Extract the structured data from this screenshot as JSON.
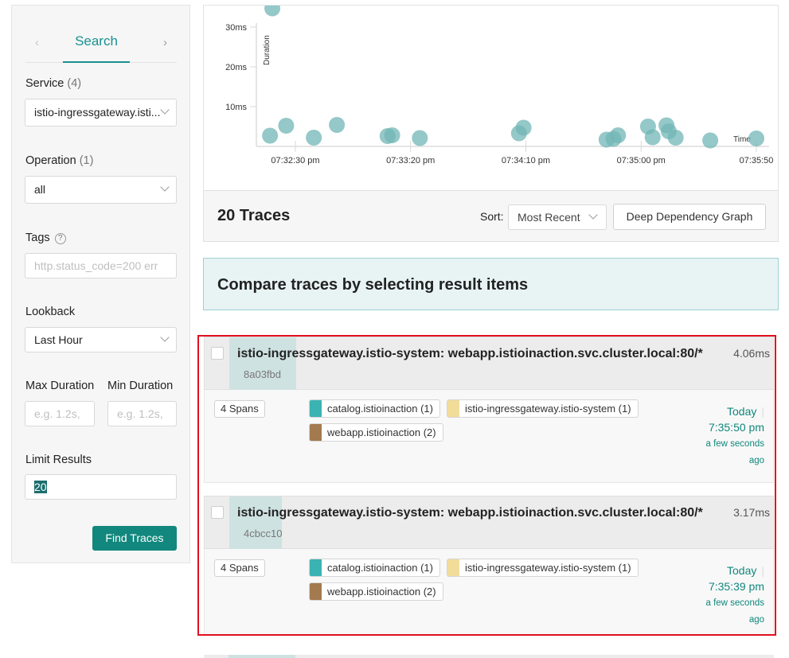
{
  "sidebar": {
    "tab_search": "Search",
    "tab_prev_icon": "‹",
    "tab_next_icon": "›",
    "service_label": "Service",
    "service_count": "(4)",
    "service_value": "istio-ingressgateway.isti...",
    "operation_label": "Operation",
    "operation_count": "(1)",
    "operation_value": "all",
    "tags_label": "Tags",
    "tags_help_icon": "?",
    "tags_placeholder": "http.status_code=200 err",
    "lookback_label": "Lookback",
    "lookback_value": "Last Hour",
    "max_duration_label": "Max Duration",
    "max_duration_placeholder": "e.g. 1.2s,",
    "min_duration_label": "Min Duration",
    "min_duration_placeholder": "e.g. 1.2s,",
    "limit_label": "Limit Results",
    "limit_value": "20",
    "find_button": "Find Traces"
  },
  "chart_data": {
    "type": "scatter",
    "xlabel": "Time",
    "ylabel": "Duration",
    "y_ticks": [
      "10ms",
      "20ms",
      "30ms"
    ],
    "x_ticks": [
      "07:32:30 pm",
      "07:33:20 pm",
      "07:34:10 pm",
      "07:35:00 pm",
      "07:35:50"
    ],
    "point_color": "#71b5b5",
    "points": [
      {
        "x": "07:32:20",
        "y": 33.5
      },
      {
        "x": "07:32:19",
        "y": 1.5
      },
      {
        "x": "07:32:26",
        "y": 4.0
      },
      {
        "x": "07:32:38",
        "y": 1.0
      },
      {
        "x": "07:32:48",
        "y": 4.2
      },
      {
        "x": "07:33:10",
        "y": 1.4
      },
      {
        "x": "07:33:12",
        "y": 1.6
      },
      {
        "x": "07:33:24",
        "y": 0.9
      },
      {
        "x": "07:34:07",
        "y": 2.1
      },
      {
        "x": "07:34:09",
        "y": 3.5
      },
      {
        "x": "07:34:45",
        "y": 0.5
      },
      {
        "x": "07:34:48",
        "y": 0.7
      },
      {
        "x": "07:34:50",
        "y": 1.6
      },
      {
        "x": "07:35:03",
        "y": 3.8
      },
      {
        "x": "07:35:05",
        "y": 1.1
      },
      {
        "x": "07:35:11",
        "y": 4.1
      },
      {
        "x": "07:35:12",
        "y": 2.6
      },
      {
        "x": "07:35:15",
        "y": 1.0
      },
      {
        "x": "07:35:30",
        "y": 0.3
      },
      {
        "x": "07:35:50",
        "y": 0.8
      }
    ]
  },
  "results": {
    "count_label": "20 Traces",
    "sort_label": "Sort:",
    "sort_value": "Most Recent",
    "ddg_button": "Deep Dependency Graph",
    "compare_text": "Compare traces by selecting result items"
  },
  "traces": [
    {
      "title": "istio-ingressgateway.istio-system: webapp.istioinaction.svc.cluster.local:80/*",
      "id": "8a03fbd",
      "duration": "4.06ms",
      "spans": "4 Spans",
      "services": [
        {
          "name": "catalog.istioinaction (1)",
          "color": "#3bb3b3"
        },
        {
          "name": "istio-ingressgateway.istio-system (1)",
          "color": "#f2dc9a"
        },
        {
          "name": "webapp.istioinaction (2)",
          "color": "#a37a4f"
        }
      ],
      "day": "Today",
      "time": "7:35:50 pm",
      "ago_line1": "a few seconds",
      "ago_line2": "ago"
    },
    {
      "title": "istio-ingressgateway.istio-system: webapp.istioinaction.svc.cluster.local:80/*",
      "id": "4cbcc10",
      "duration": "3.17ms",
      "spans": "4 Spans",
      "services": [
        {
          "name": "catalog.istioinaction (1)",
          "color": "#3bb3b3"
        },
        {
          "name": "istio-ingressgateway.istio-system (1)",
          "color": "#f2dc9a"
        },
        {
          "name": "webapp.istioinaction (2)",
          "color": "#a37a4f"
        }
      ],
      "day": "Today",
      "time": "7:35:39 pm",
      "ago_line1": "a few seconds",
      "ago_line2": "ago"
    }
  ]
}
